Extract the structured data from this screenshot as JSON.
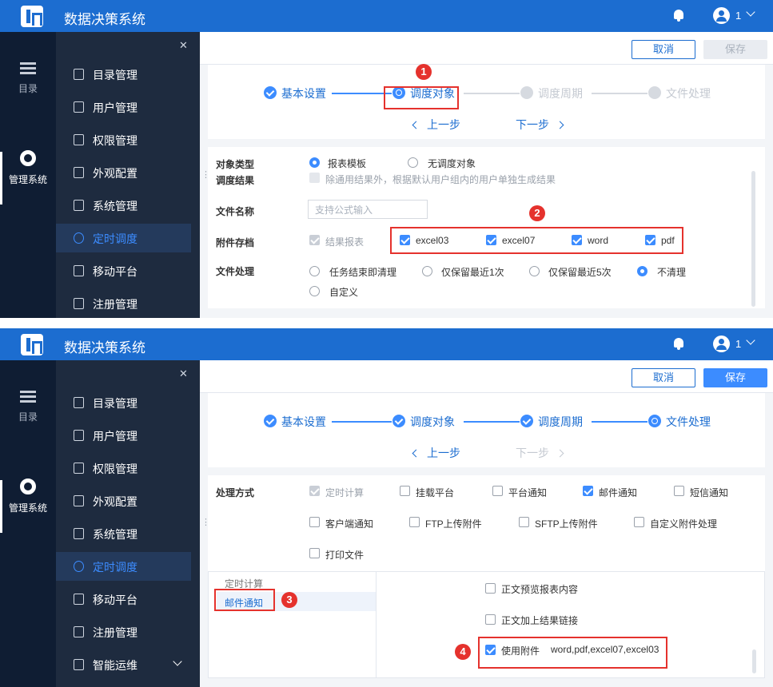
{
  "app": {
    "title": "数据决策系统",
    "username": "1"
  },
  "rail": {
    "catalog": "目录",
    "manage": "管理系统"
  },
  "nav": [
    "目录管理",
    "用户管理",
    "权限管理",
    "外观配置",
    "系统管理",
    "定时调度",
    "移动平台",
    "注册管理",
    "智能运维"
  ],
  "toolbar": {
    "cancel": "取消",
    "save": "保存"
  },
  "steps": [
    "基本设置",
    "调度对象",
    "调度周期",
    "文件处理"
  ],
  "pager": {
    "prev": "上一步",
    "next": "下一步"
  },
  "badges": [
    "1",
    "2",
    "3",
    "4"
  ],
  "panel1": {
    "object_type": {
      "label": "对象类型",
      "opt1": "报表模板",
      "opt2": "无调度对象",
      "selected": "报表模板"
    },
    "schedule_result": {
      "label": "调度结果",
      "text": "除通用结果外，根据默认用户组内的用户单独生成结果"
    },
    "file_name": {
      "label": "文件名称",
      "placeholder": "支持公式输入"
    },
    "attachment": {
      "label": "附件存档",
      "result_report": "结果报表",
      "formats": [
        "excel03",
        "excel07",
        "word",
        "pdf"
      ]
    },
    "file_process": {
      "label": "文件处理",
      "options": [
        "任务结束即清理",
        "仅保留最近1次",
        "仅保留最近5次",
        "不清理",
        "自定义"
      ],
      "selected": "不清理"
    }
  },
  "panel2": {
    "method": {
      "label": "处理方式",
      "options": [
        "定时计算",
        "挂载平台",
        "平台通知",
        "邮件通知",
        "短信通知",
        "客户端通知",
        "FTP上传附件",
        "SFTP上传附件",
        "自定义附件处理",
        "打印文件"
      ],
      "checked": [
        "定时计算",
        "邮件通知"
      ]
    },
    "tabs": [
      "定时计算",
      "邮件通知"
    ],
    "email": {
      "preview": "正文预览报表内容",
      "link": "正文加上结果链接",
      "use_attach": "使用附件",
      "attach_value": "word,pdf,excel07,excel03"
    }
  }
}
